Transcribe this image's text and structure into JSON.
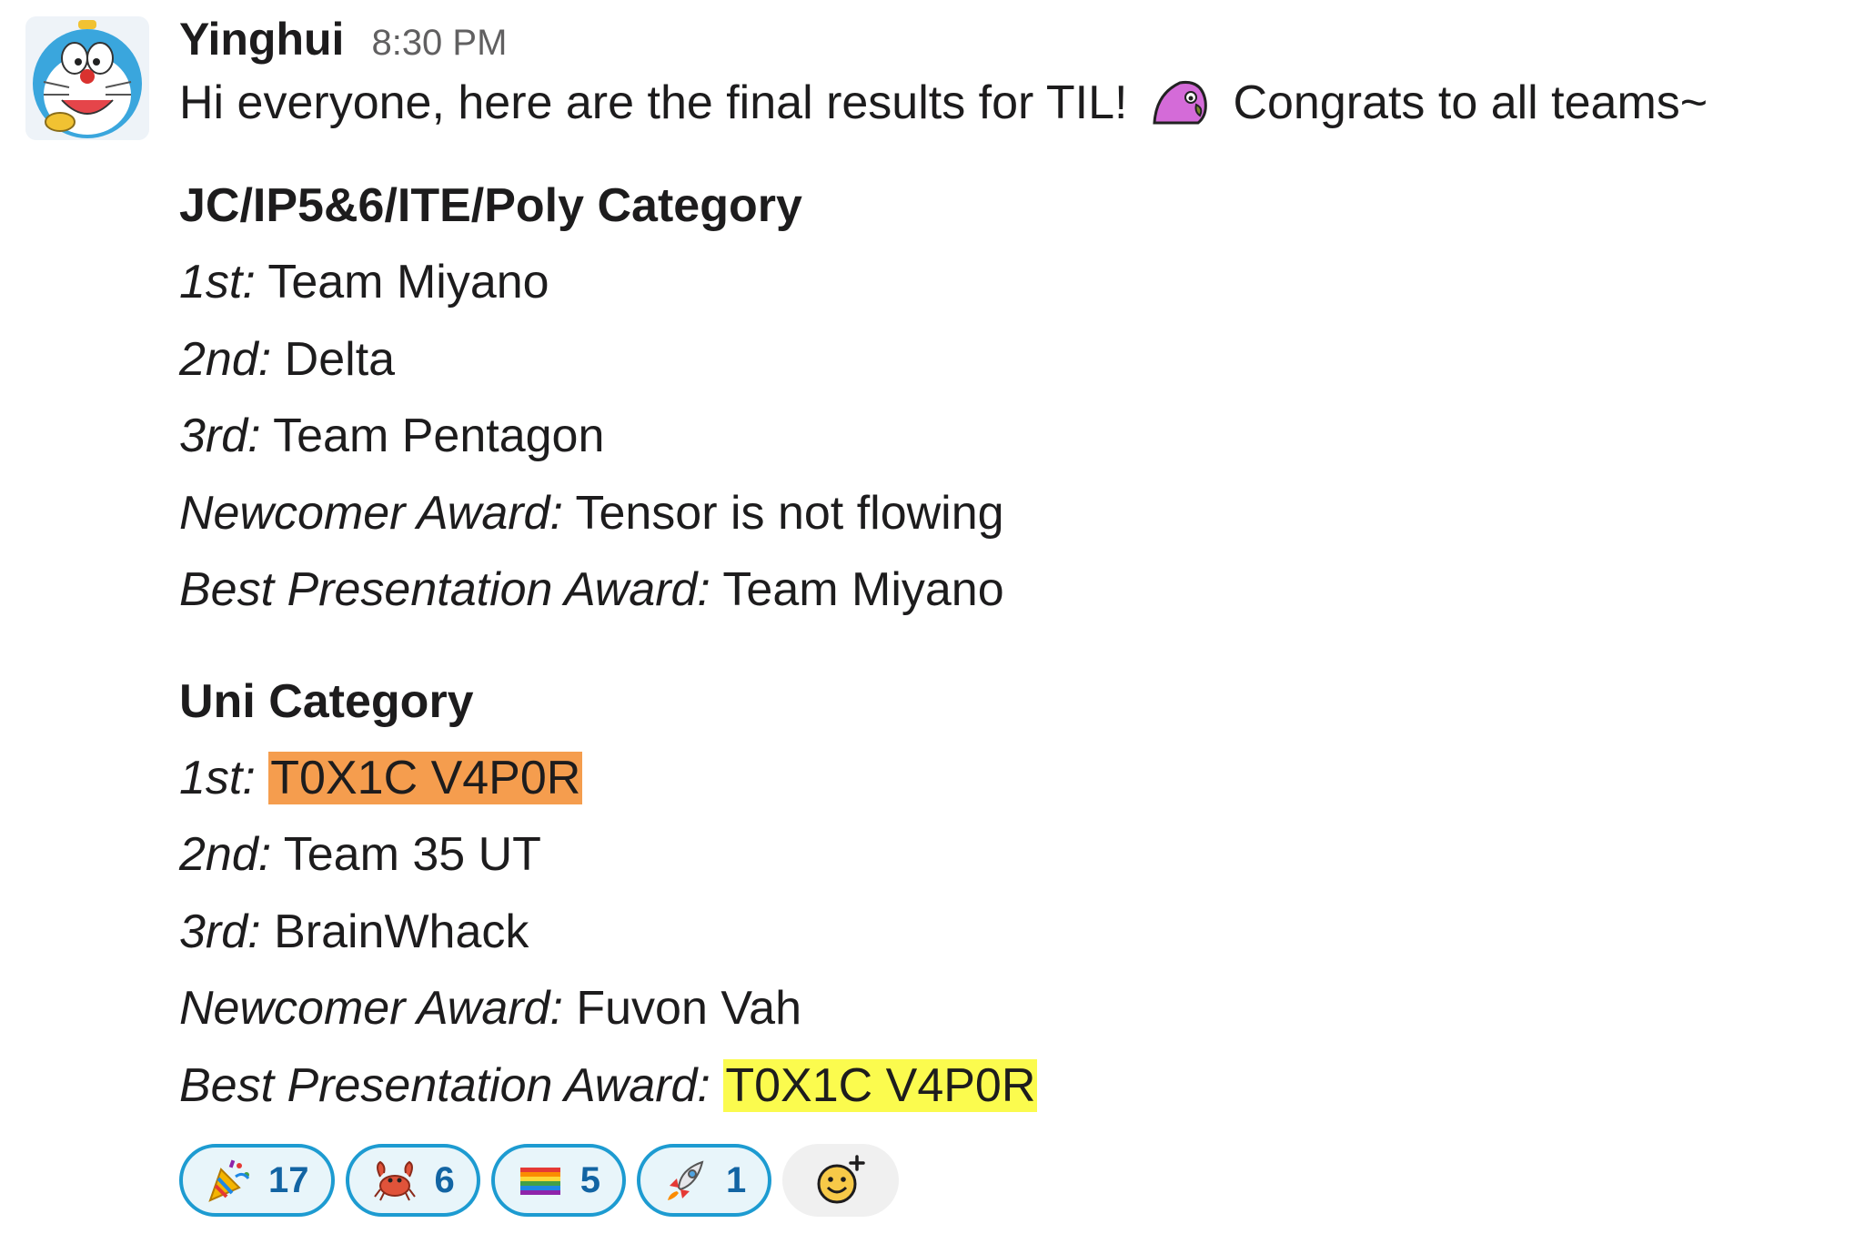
{
  "message": {
    "username": "Yinghui",
    "timestamp": "8:30 PM",
    "intro_before": "Hi everyone, here are the final results for TIL!",
    "intro_emoji": "party-parrot-emoji",
    "intro_after": "Congrats to all teams~",
    "sections": [
      {
        "title": "JC/IP5&6/ITE/Poly Category",
        "entries": [
          {
            "label": "1st:",
            "value": "Team Miyano",
            "highlight": ""
          },
          {
            "label": "2nd:",
            "value": "Delta",
            "highlight": ""
          },
          {
            "label": "3rd:",
            "value": "Team Pentagon",
            "highlight": ""
          },
          {
            "label": "Newcomer Award:",
            "value": "Tensor is not flowing",
            "highlight": ""
          },
          {
            "label": "Best Presentation Award:",
            "value": "Team Miyano",
            "highlight": ""
          }
        ]
      },
      {
        "title": "Uni Category",
        "entries": [
          {
            "label": "1st:",
            "value": "T0X1C V4P0R",
            "highlight": "#f59d4e"
          },
          {
            "label": "2nd:",
            "value": "Team 35 UT",
            "highlight": ""
          },
          {
            "label": "3rd:",
            "value": "BrainWhack",
            "highlight": ""
          },
          {
            "label": "Newcomer Award:",
            "value": "Fuvon Vah",
            "highlight": ""
          },
          {
            "label": "Best Presentation Award:",
            "value": "T0X1C V4P0R",
            "highlight": "#fbfb4e"
          }
        ]
      }
    ],
    "reactions": [
      {
        "emoji": "party-popper-icon",
        "count": "17"
      },
      {
        "emoji": "crab-icon",
        "count": "6"
      },
      {
        "emoji": "rainbow-flag-icon",
        "count": "5"
      },
      {
        "emoji": "rocket-icon",
        "count": "1"
      }
    ],
    "add_reaction_icon": "add-reaction-icon"
  },
  "colors": {
    "reaction_border": "#1d9bd1",
    "reaction_bg": "#e8f5fa",
    "reaction_count": "#1264a3",
    "timestamp": "#616061"
  }
}
